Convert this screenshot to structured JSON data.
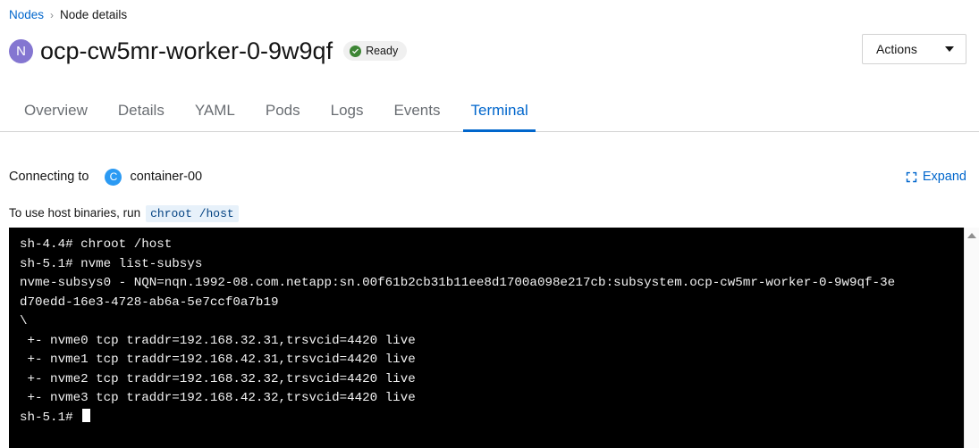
{
  "breadcrumb": {
    "parent": "Nodes",
    "separator": "›",
    "current": "Node details"
  },
  "header": {
    "node_initial": "N",
    "title": "ocp-cw5mr-worker-0-9w9qf",
    "status": "Ready",
    "status_color": "#3e8635",
    "actions_label": "Actions"
  },
  "tabs": [
    {
      "label": "Overview",
      "active": false
    },
    {
      "label": "Details",
      "active": false
    },
    {
      "label": "YAML",
      "active": false
    },
    {
      "label": "Pods",
      "active": false
    },
    {
      "label": "Logs",
      "active": false
    },
    {
      "label": "Events",
      "active": false
    },
    {
      "label": "Terminal",
      "active": true
    }
  ],
  "terminal_panel": {
    "connecting_label": "Connecting to",
    "container_initial": "C",
    "container_name": "container-00",
    "expand_label": "Expand",
    "hint_text": "To use host binaries, run",
    "hint_code": "chroot /host",
    "accent_color": "#0066cc",
    "container_badge_color": "#2b9af3",
    "node_badge_color": "#8476d1",
    "terminal_bg": "#000000",
    "terminal_fg": "#f2f2f2",
    "lines": [
      "sh-4.4# chroot /host",
      "sh-5.1# nvme list-subsys",
      "nvme-subsys0 - NQN=nqn.1992-08.com.netapp:sn.00f61b2cb31b11ee8d1700a098e217cb:subsystem.ocp-cw5mr-worker-0-9w9qf-3e",
      "d70edd-16e3-4728-ab6a-5e7ccf0a7b19",
      "\\",
      " +- nvme0 tcp traddr=192.168.32.31,trsvcid=4420 live",
      " +- nvme1 tcp traddr=192.168.42.31,trsvcid=4420 live",
      " +- nvme2 tcp traddr=192.168.32.32,trsvcid=4420 live",
      " +- nvme3 tcp traddr=192.168.42.32,trsvcid=4420 live"
    ],
    "prompt": "sh-5.1# "
  }
}
